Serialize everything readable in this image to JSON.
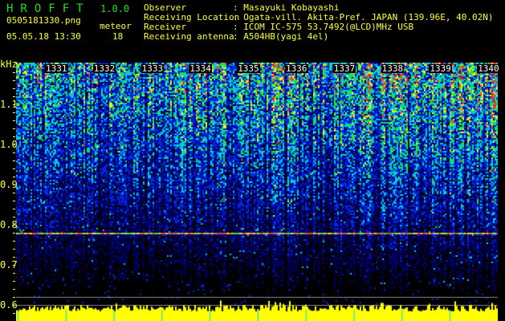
{
  "header": {
    "app_title": "HROFFT",
    "version": "1.0.0",
    "filename": "0505181330.png",
    "datetime": "05.05.18 13:30",
    "meteor_label": "meteor",
    "meteor_count": "18"
  },
  "info": [
    {
      "label": "Observer",
      "value": ": Masayuki Kobayashi"
    },
    {
      "label": "Receiving Location",
      "value": ": Ogata-vill. Akita-Pref. JAPAN (139.96E, 40.02N)"
    },
    {
      "label": "Receiver",
      "value": ": ICOM IC-575 53.7492(@LCD)MHz USB"
    },
    {
      "label": "Receiving antenna",
      "value": ": A504HB(yagi 4el)"
    }
  ],
  "colors": {
    "text": "#ffff33",
    "title": "#22dd22",
    "noise_line": "#ff3355",
    "histogram": "#ffff00"
  },
  "chart_data": {
    "type": "heatmap",
    "ylabel": "kHz",
    "yticks": [
      "1.1",
      "1.0",
      "0.9",
      "0.8",
      "0.7",
      "0.6"
    ],
    "ylim": [
      0.6,
      1.2
    ],
    "xticks": [
      "1331",
      "1332",
      "1333",
      "1334",
      "1335",
      "1336",
      "1337",
      "1338",
      "1339",
      "1340"
    ],
    "xlim": [
      "1330",
      "1340"
    ],
    "colormap": [
      "black",
      "blue",
      "cyan",
      "green",
      "yellow",
      "red"
    ],
    "horizontal_line_khz": 0.78,
    "gray_lines_khz": [
      0.6,
      0.62
    ]
  }
}
